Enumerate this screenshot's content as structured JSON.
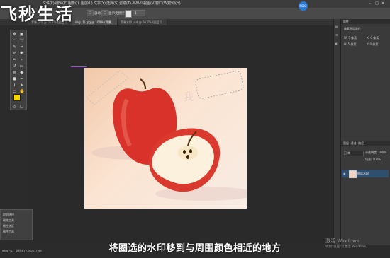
{
  "app": {
    "menu": [
      "文件(F)",
      "编辑(E)",
      "图像(I)",
      "图层(L)",
      "文字(Y)",
      "选择(S)",
      "滤镜(T)",
      "3D(D)",
      "视图(V)",
      "窗口(W)",
      "帮助(H)"
    ],
    "menu_badge": "5002",
    "options": {
      "all_layers_label": "自动选择",
      "transform_label": "显示变换控件",
      "value": "1"
    },
    "tabs": [
      {
        "label": "苹果.psd @ 66.7% (图层 1, RGB/8) *"
      },
      {
        "label": "img (1).jpg @ 100% (背景, RGB/8)"
      },
      {
        "label": "苹果水印.psd @ 66.7% (图层 1, RGB/8) *"
      }
    ]
  },
  "logo": "飞秒生活",
  "watermark_text": "我",
  "history": {
    "items": [
      "取消选择",
      "磁性工具",
      "磁性选区",
      "磁性工具"
    ]
  },
  "right_panel": {
    "top_title": "属性",
    "props_title": "像素图层属性",
    "W_label": "W: 5 像素",
    "H_label": "H: 5 像素",
    "X_label": "X: 0 像素",
    "Y_label": "Y: 0 像素",
    "layers_tabs": [
      "图层",
      "通道",
      "路径"
    ],
    "blend_mode": "正常",
    "opacity": "不透明度: 100%",
    "fill": "填充: 100%",
    "layer_name": "图层水印"
  },
  "status": {
    "zoom": "66.67%",
    "doc_info": "文档:877.9K/877.9K"
  },
  "subtitle": "将圈选的水印移到与周围颜色相近的地方",
  "activate_windows": {
    "title": "激活 Windows",
    "sub": "转到\"设置\"以激活 Windows。"
  },
  "colors": {
    "foreground": "#f6d500",
    "background": "#ffffff",
    "layer_highlight": "#2f4f70",
    "apple_red": "#d8322b",
    "canvas_bg_start": "#f2c8a9"
  }
}
